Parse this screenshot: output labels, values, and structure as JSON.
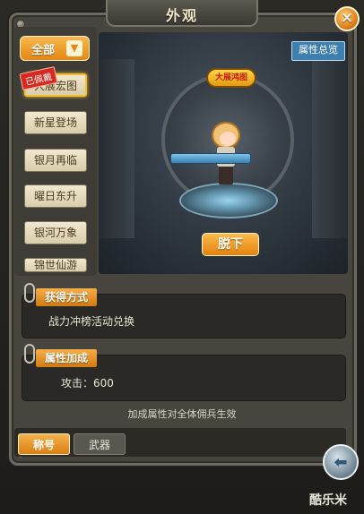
{
  "window": {
    "title": "外观",
    "close_icon": "close-icon"
  },
  "sidebar": {
    "filter_label": "全部",
    "equipped_tag": "已佩戴",
    "items": [
      {
        "label": "大展宏图",
        "selected": true
      },
      {
        "label": "新星登场",
        "selected": false
      },
      {
        "label": "银月再临",
        "selected": false
      },
      {
        "label": "曜日东升",
        "selected": false
      },
      {
        "label": "银河万象",
        "selected": false
      },
      {
        "label": "锦世仙游",
        "selected": false
      }
    ]
  },
  "preview": {
    "summary_button": "属性总览",
    "badge": "大展鸿图",
    "action_button": "脱下"
  },
  "obtain": {
    "label": "获得方式",
    "text": "战力冲榜活动兑换"
  },
  "attributes": {
    "label": "属性加成",
    "text": "攻击：600",
    "note": "加成属性对全体佣兵生效"
  },
  "tabs": [
    {
      "label": "称号",
      "active": true
    },
    {
      "label": "武器",
      "active": false
    }
  ],
  "watermark": "酷乐米",
  "colors": {
    "accent": "#e48715",
    "panel": "#47453e",
    "highlight": "#f0c032"
  }
}
